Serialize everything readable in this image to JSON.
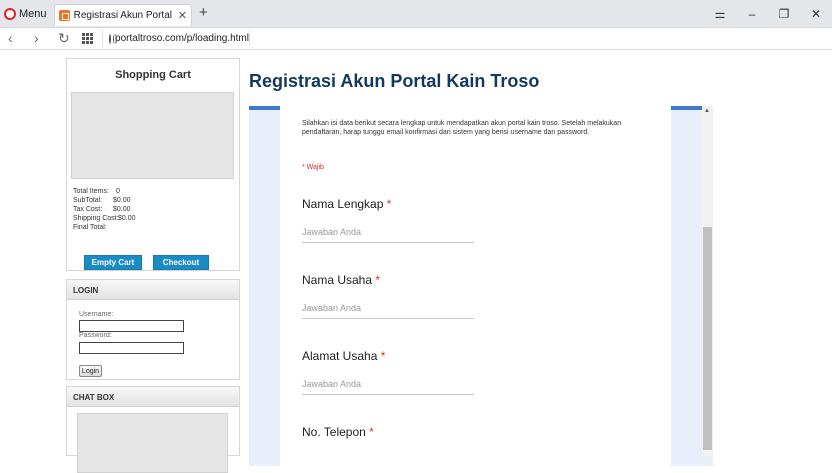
{
  "browser": {
    "menu_label": "Menu",
    "tab_title": "Registrasi Akun Portal Kain",
    "tab_close": "✕",
    "new_tab": "+",
    "url": "portaltroso.com/p/loading.html",
    "window_controls": [
      "⚌",
      "–",
      "❐",
      "✕"
    ]
  },
  "sidebar": {
    "cart": {
      "title": "Shopping Cart",
      "rows": [
        {
          "label": "Total Items:",
          "value": "0"
        },
        {
          "label": "SubTotal:",
          "value": "$0.00"
        },
        {
          "label": "Tax Cost:",
          "value": "$0.00"
        },
        {
          "label": "Shipping Cost:",
          "value": "$0.00"
        },
        {
          "label": "Final Total:",
          "value": ""
        }
      ],
      "empty_button": "Empty Cart",
      "checkout_button": "Checkout"
    },
    "login": {
      "title": "LOGIN",
      "username_label": "Username:",
      "password_label": "Password:",
      "button": "Login"
    },
    "chat": {
      "title": "CHAT BOX"
    }
  },
  "main": {
    "title": "Registrasi Akun Portal Kain Troso",
    "intro": "Silahkan isi data berikut secara lengkap untuk mendapatkan akun portal kain troso. Setelah melakukan pendaftaran, harap tunggu email konfirmasi dari sistem yang berisi username dan password.",
    "required_note": "* Wajib",
    "questions": [
      {
        "label": "Nama Lengkap",
        "star": "*",
        "placeholder": "Jawaban Anda"
      },
      {
        "label": "Nama Usaha",
        "star": "*",
        "placeholder": "Jawaban Anda"
      },
      {
        "label": "Alamat Usaha",
        "star": "*",
        "placeholder": "Jawaban Anda"
      },
      {
        "label": "No. Telepon",
        "star": "*",
        "placeholder": ""
      }
    ]
  },
  "colors": {
    "title": "#12395e",
    "accent_blue": "#3d79d3",
    "button_blue": "#1b8bc5",
    "required_red": "#d93025"
  }
}
